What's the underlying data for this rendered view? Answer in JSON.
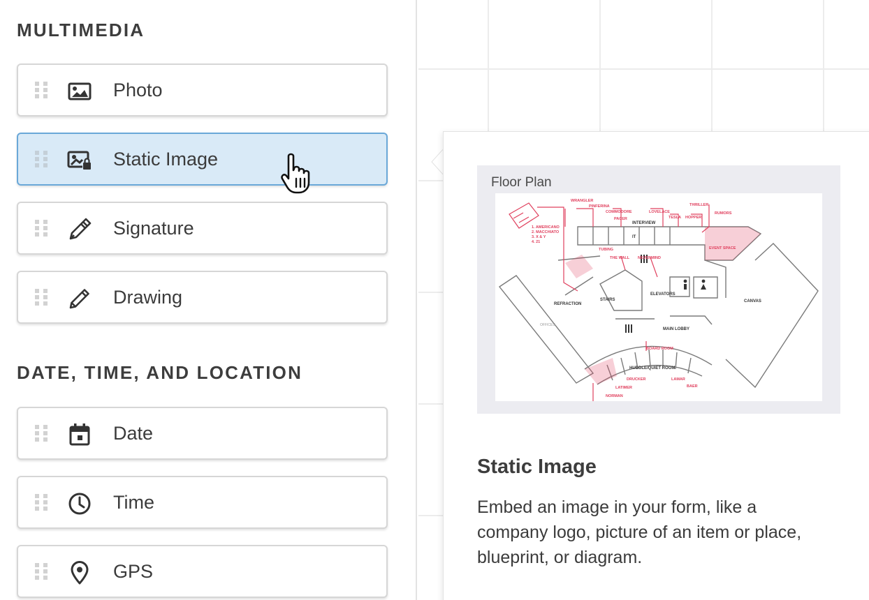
{
  "sections": [
    {
      "title": "MULTIMEDIA"
    },
    {
      "title": "DATE, TIME, AND LOCATION"
    }
  ],
  "fields": [
    {
      "label": "Photo",
      "icon": "photo-icon"
    },
    {
      "label": "Static Image",
      "icon": "static-image-icon",
      "state": "hovered"
    },
    {
      "label": "Signature",
      "icon": "signature-pen-icon"
    },
    {
      "label": "Drawing",
      "icon": "pencil-icon"
    },
    {
      "label": "Date",
      "icon": "calendar-icon"
    },
    {
      "label": "Time",
      "icon": "clock-icon"
    },
    {
      "label": "GPS",
      "icon": "location-pin-icon"
    }
  ],
  "preview": {
    "image_caption": "Floor Plan",
    "title": "Static Image",
    "description": "Embed an image in your form, like a company logo, picture of an item or place, blueprint, or diagram."
  },
  "colors": {
    "active_background": "#d9eaf7",
    "active_border": "#6aa8d8",
    "floorplan_accent": "#e0405e"
  }
}
